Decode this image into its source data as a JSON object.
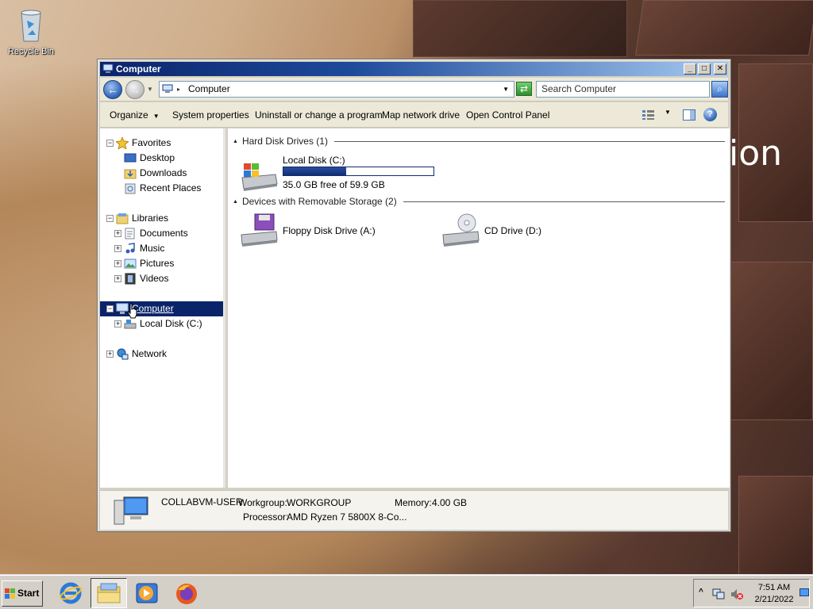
{
  "desktop": {
    "recycle_bin_label": "Recycle Bin",
    "wallpaper_text": "ion"
  },
  "window": {
    "title": "Computer",
    "controls": {
      "minimize": "_",
      "maximize": "□",
      "close": "✕"
    }
  },
  "address_bar": {
    "path": "Computer",
    "search_placeholder": "Search Computer"
  },
  "toolbar": {
    "organize": "Organize",
    "system_properties": "System properties",
    "uninstall": "Uninstall or change a program",
    "map_drive": "Map network drive",
    "control_panel": "Open Control Panel",
    "help": "?"
  },
  "nav": {
    "favorites": "Favorites",
    "desktop": "Desktop",
    "downloads": "Downloads",
    "recent_places": "Recent Places",
    "libraries": "Libraries",
    "documents": "Documents",
    "music": "Music",
    "pictures": "Pictures",
    "videos": "Videos",
    "computer": "Computer",
    "local_disk": "Local Disk (C:)",
    "network": "Network"
  },
  "content": {
    "hdd_group": "Hard Disk Drives (1)",
    "removable_group": "Devices with Removable Storage (2)",
    "local_disk": {
      "name": "Local Disk (C:)",
      "space": "35.0 GB free of 59.9 GB",
      "used_fraction": 0.416
    },
    "floppy": "Floppy Disk Drive (A:)",
    "cd": "CD Drive (D:)"
  },
  "details": {
    "computer_name": "COLLABVM-USER",
    "workgroup_label": "Workgroup:",
    "workgroup_value": "WORKGROUP",
    "memory_label": "Memory:",
    "memory_value": "4.00 GB",
    "processor_label": "Processor:",
    "processor_value": "AMD Ryzen 7 5800X 8-Co..."
  },
  "taskbar": {
    "start": "Start",
    "apps": [
      "internet-explorer-icon",
      "windows-explorer-icon",
      "media-player-icon",
      "firefox-icon"
    ],
    "time": "7:51 AM",
    "date": "2/21/2022",
    "tray_arrow": "^"
  }
}
